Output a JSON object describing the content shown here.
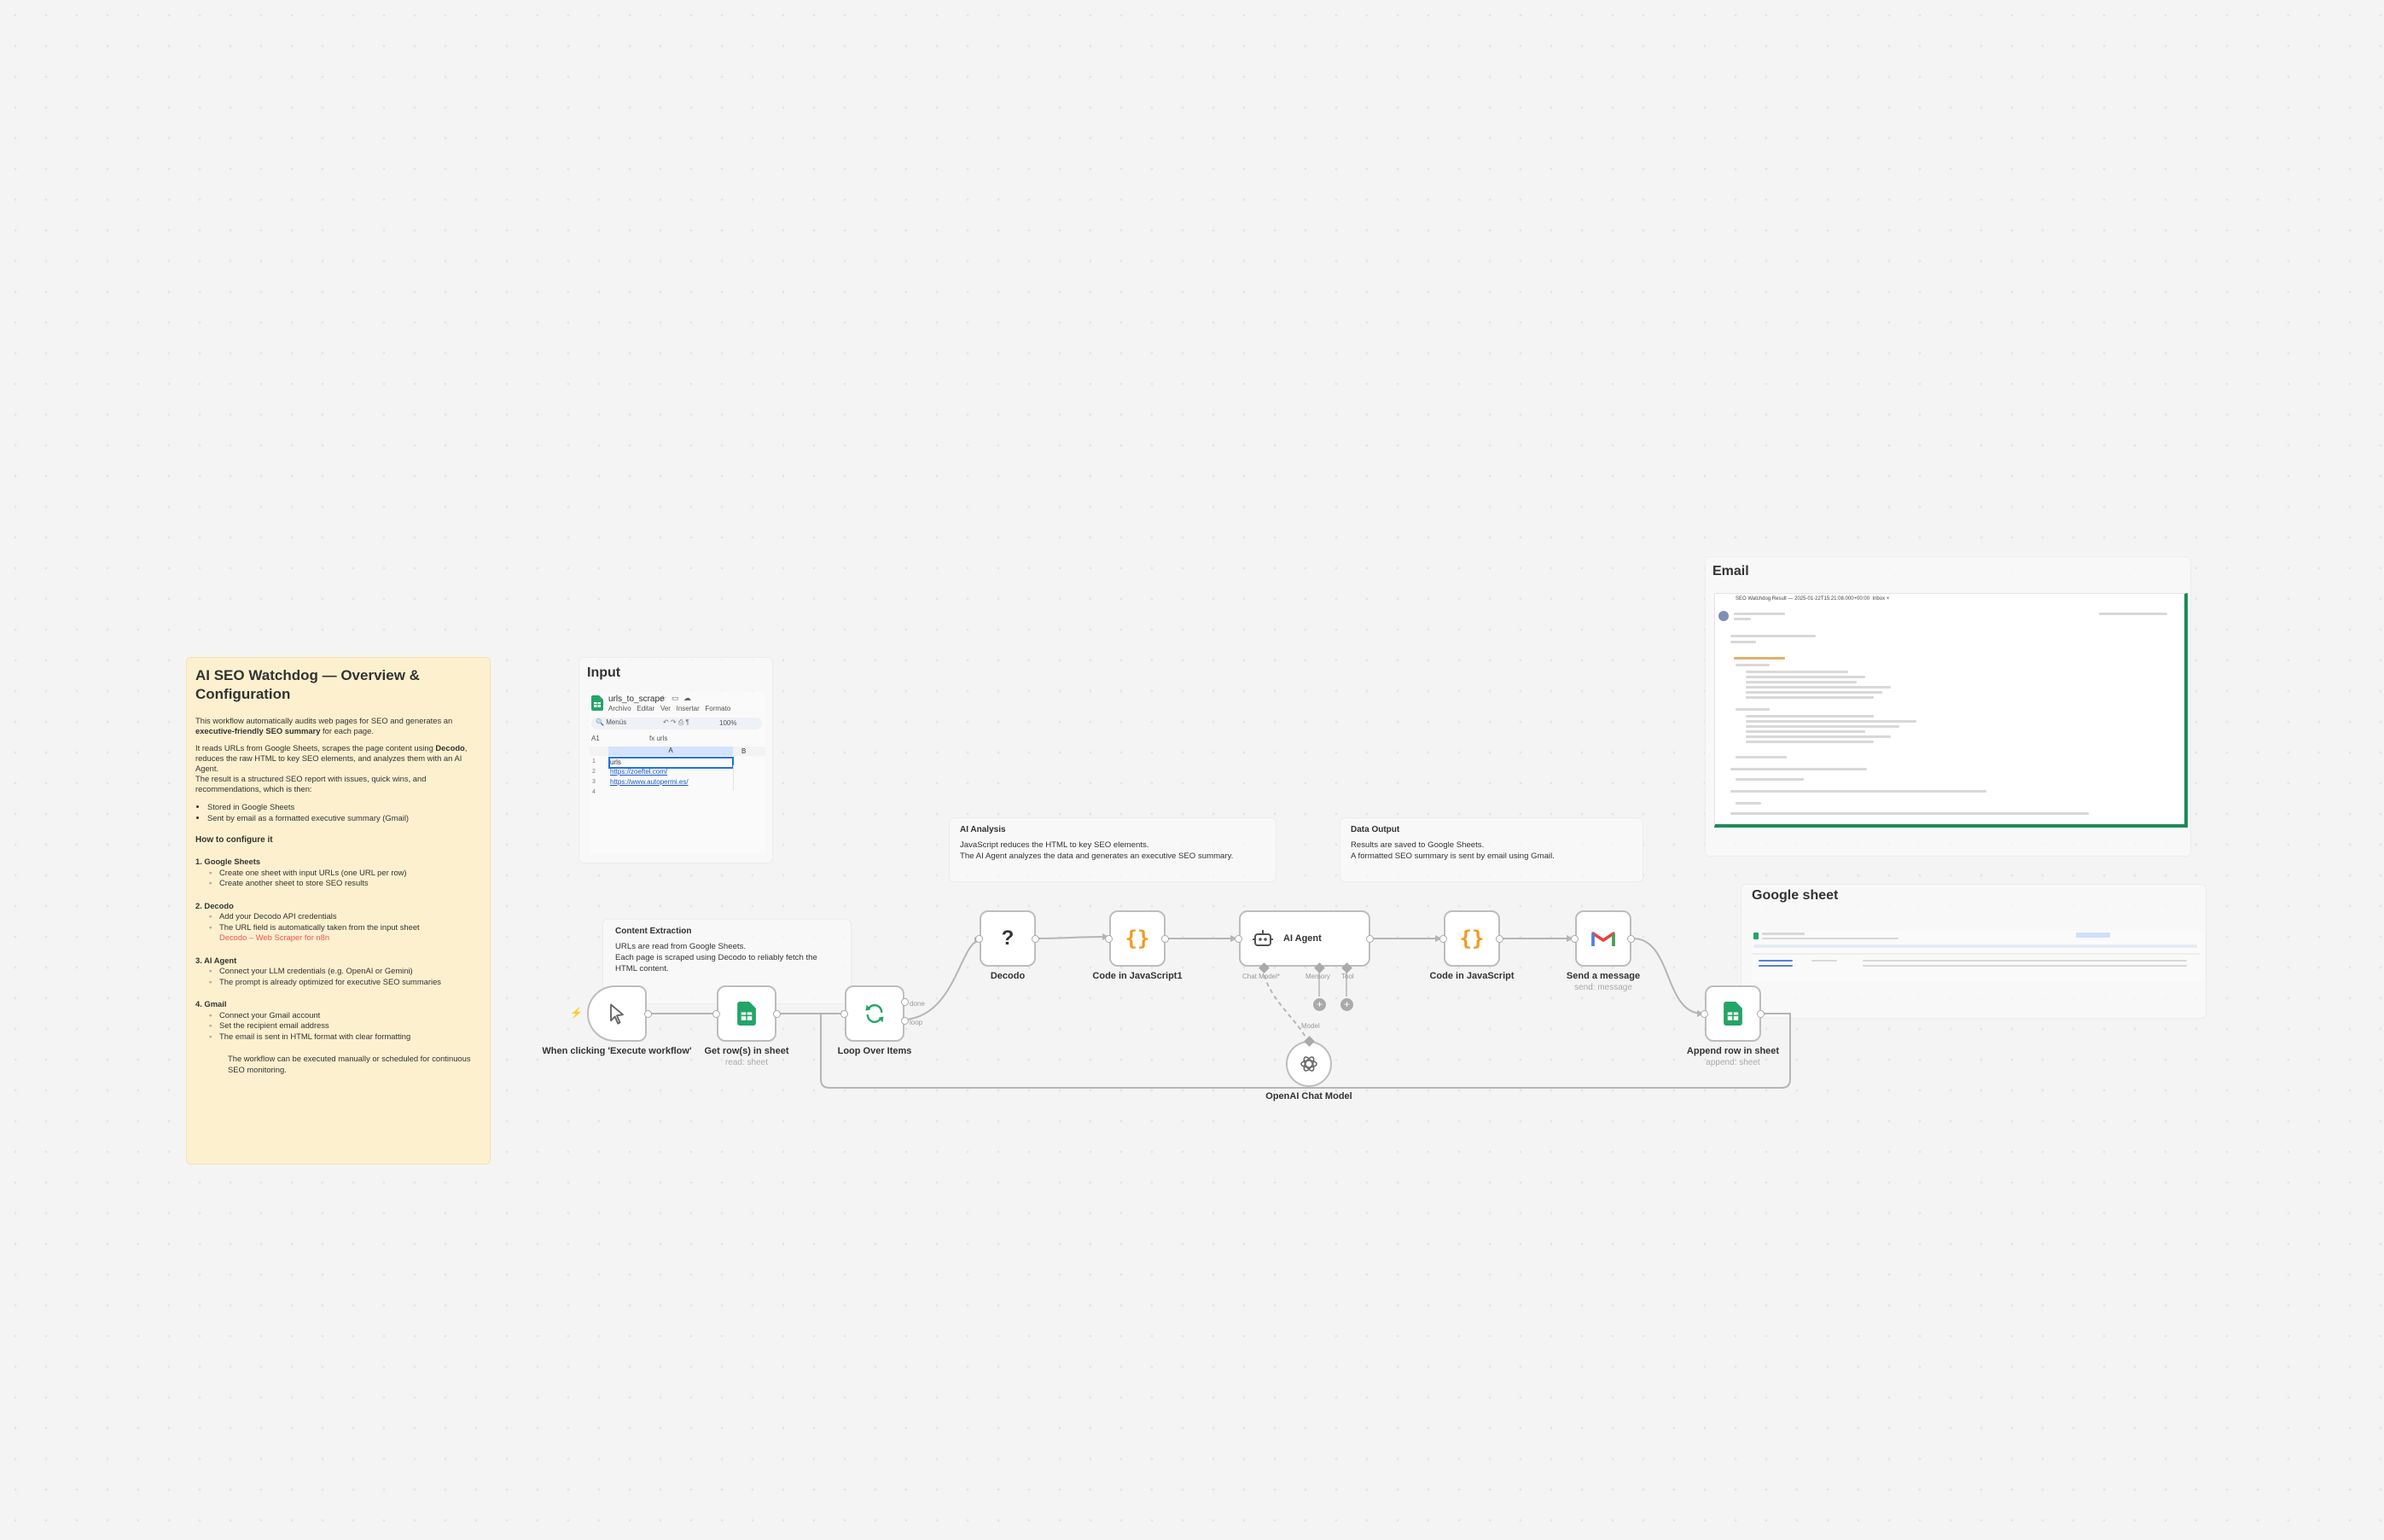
{
  "overview": {
    "title": "AI SEO Watchdog — Overview & Configuration",
    "intro1_a": "This workflow automatically audits web pages for SEO and generates an ",
    "intro1_b": "executive-friendly SEO summary",
    "intro1_c": " for each page.",
    "intro2_a": "It reads URLs from Google Sheets, scrapes the page content using ",
    "intro2_b": "Decodo",
    "intro2_c": ", reduces the raw HTML to key SEO elements, and analyzes them with an AI Agent.",
    "intro3": "The result is a structured SEO report with issues, quick wins, and recommendations, which is then:",
    "bullets": [
      "Stored in Google Sheets",
      "Sent by email as a formatted executive summary (Gmail)"
    ],
    "how_title": "How to configure it",
    "s1_title": "1. Google Sheets",
    "s1_items": [
      "Create one sheet with input URLs (one URL per row)",
      "Create another sheet to store SEO results"
    ],
    "s2_title": "2. Decodo",
    "s2_items": [
      "Add your Decodo API credentials",
      "The URL field is automatically taken from the input sheet"
    ],
    "s2_red": "Decodo – Web Scraper for n8n",
    "s3_title": "3. AI Agent",
    "s3_items": [
      "Connect your LLM credentials (e.g. OpenAI or Gemini)",
      "The prompt is already optimized for executive SEO summaries"
    ],
    "s4_title": "4. Gmail",
    "s4_items": [
      "Connect your Gmail account",
      "Set the recipient email address",
      "The email is sent in HTML format with clear formatting"
    ],
    "final": "The workflow can be executed manually or scheduled for continuous SEO monitoring."
  },
  "input": {
    "label": "Input",
    "sheet_name": "urls_to_scrape",
    "menus": [
      "Archivo",
      "Editar",
      "Ver",
      "Insertar",
      "Formato"
    ],
    "search": "Menús",
    "zoom": "100%",
    "cell_ref": "A1",
    "fx_value": "urls",
    "col_a": "A",
    "col_b": "B",
    "rows": [
      "urls",
      "https://zoeftel.com/",
      "https://www.autopermi.es/"
    ]
  },
  "email_section": {
    "label": "Email",
    "subject": "SEO Watchdog Result — 2025-01-22T15:21:08.000+00:00",
    "inbox": "Inbox"
  },
  "gsheet_section": {
    "label": "Google sheet"
  },
  "notes": {
    "content_title": "Content Extraction",
    "content_body1": "URLs are read from Google Sheets.",
    "content_body2": "Each page is scraped using Decodo to reliably fetch the HTML content.",
    "ai_title": "AI Analysis",
    "ai_body1": "JavaScript reduces the HTML to key SEO elements.",
    "ai_body2": "The AI Agent analyzes the data and generates an executive SEO summary.",
    "data_title": "Data Output",
    "data_body1": "Results are saved to Google Sheets.",
    "data_body2": "A formatted SEO summary is sent by email using Gmail."
  },
  "nodes": {
    "trigger": {
      "label": "When clicking 'Execute workflow'"
    },
    "get_rows": {
      "label": "Get row(s) in sheet",
      "sub": "read: sheet"
    },
    "loop": {
      "label": "Loop Over Items",
      "done": "done",
      "loop": "loop"
    },
    "decodo": {
      "label": "Decodo"
    },
    "code1": {
      "label": "Code in JavaScript1"
    },
    "agent": {
      "label": "AI Agent",
      "p1": "Chat Model*",
      "p2": "Memory",
      "p3": "Tool"
    },
    "code2": {
      "label": "Code in JavaScript"
    },
    "gmail": {
      "label": "Send a message",
      "sub": "send: message"
    },
    "append": {
      "label": "Append row in sheet",
      "sub": "append: sheet"
    },
    "openai": {
      "label": "OpenAI Chat Model",
      "model": "Model"
    }
  },
  "colors": {
    "sheets_green": "#23a566",
    "code_orange": "#f29a1d",
    "sticky_yellow": "#fdf0cf",
    "red": "#e55555"
  }
}
